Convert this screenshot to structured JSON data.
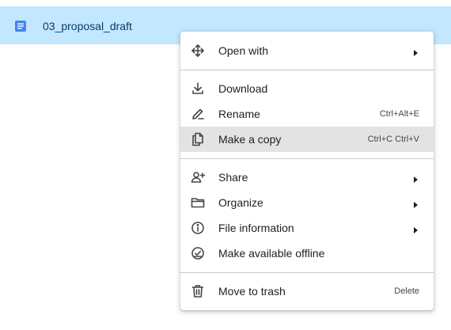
{
  "file": {
    "name": "03_proposal_draft",
    "icon": "google-doc-icon",
    "selected_color": "#c2e7ff",
    "accent_color": "#4285f4"
  },
  "context_menu": {
    "items": [
      {
        "label": "Open with",
        "icon": "move-arrows-icon",
        "submenu": true
      },
      {
        "label": "Download",
        "icon": "download-icon"
      },
      {
        "label": "Rename",
        "icon": "pencil-icon",
        "shortcut": "Ctrl+Alt+E"
      },
      {
        "label": "Make a copy",
        "icon": "copy-icon",
        "shortcut": "Ctrl+C Ctrl+V",
        "highlighted": true
      },
      {
        "label": "Share",
        "icon": "person-add-icon",
        "submenu": true
      },
      {
        "label": "Organize",
        "icon": "folder-icon",
        "submenu": true
      },
      {
        "label": "File information",
        "icon": "info-icon",
        "submenu": true
      },
      {
        "label": "Make available offline",
        "icon": "offline-check-icon"
      },
      {
        "label": "Move to trash",
        "icon": "trash-icon",
        "shortcut": "Delete"
      }
    ]
  }
}
